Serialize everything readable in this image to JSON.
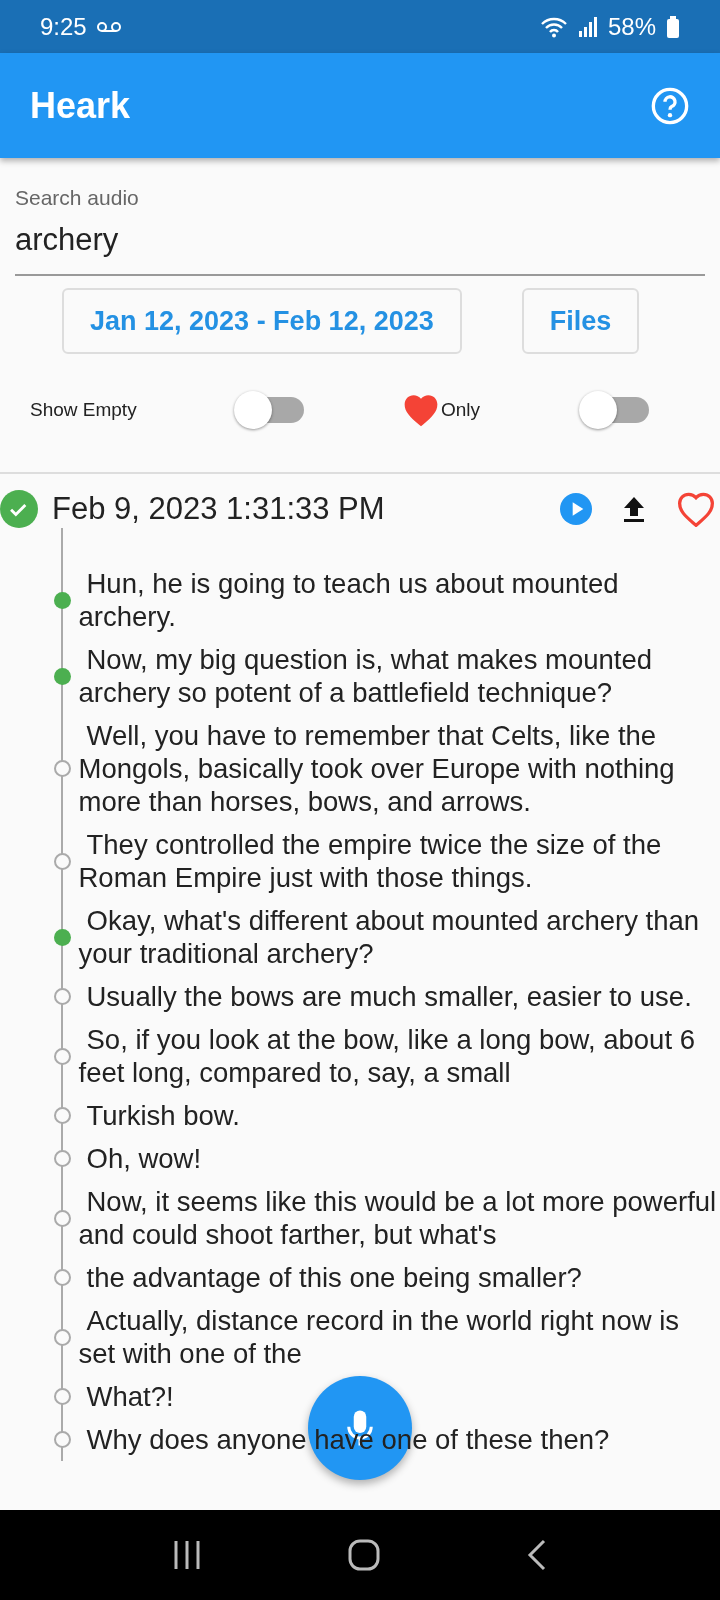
{
  "status_bar": {
    "time": "9:25",
    "battery": "58%"
  },
  "app_bar": {
    "title": "Heark"
  },
  "search": {
    "label": "Search audio",
    "value": "archery"
  },
  "filters": {
    "date_range": "Jan 12, 2023 - Feb 12, 2023",
    "files": "Files"
  },
  "toggles": [
    {
      "kind": "plain",
      "label": "Show Empty",
      "on": false
    },
    {
      "kind": "heart",
      "label": "Only",
      "on": false
    }
  ],
  "recording": {
    "timestamp": "Feb 9, 2023 1:31:33 PM",
    "favorite": false,
    "segments": [
      {
        "text": "Hun, he is going to teach us about mounted archery.",
        "marked": true
      },
      {
        "text": "Now, my big question is, what makes mounted archery so potent of a battlefield technique?",
        "marked": true
      },
      {
        "text": "Well, you have to remember that Celts, like the Mongols, basically took over Europe with nothing more than horses, bows, and arrows.",
        "marked": false
      },
      {
        "text": "They controlled the empire twice the size of the Roman Empire just with those things.",
        "marked": false
      },
      {
        "text": "Okay, what's different about mounted archery than your traditional archery?",
        "marked": true
      },
      {
        "text": "Usually the bows are much smaller, easier to use.",
        "marked": false
      },
      {
        "text": "So, if you look at the bow, like a long bow, about 6 feet long, compared to, say, a small",
        "marked": false
      },
      {
        "text": "Turkish bow.",
        "marked": false
      },
      {
        "text": "Oh, wow!",
        "marked": false
      },
      {
        "text": "Now, it seems like this would be a lot more powerful and could shoot farther, but what's",
        "marked": false
      },
      {
        "text": "the advantage of this one being smaller?",
        "marked": false
      },
      {
        "text": "Actually, distance record in the world right now is set with one of the",
        "marked": false
      },
      {
        "text": "What?!",
        "marked": false
      },
      {
        "text": "Why does anyone have one of these then?",
        "marked": false
      }
    ]
  }
}
